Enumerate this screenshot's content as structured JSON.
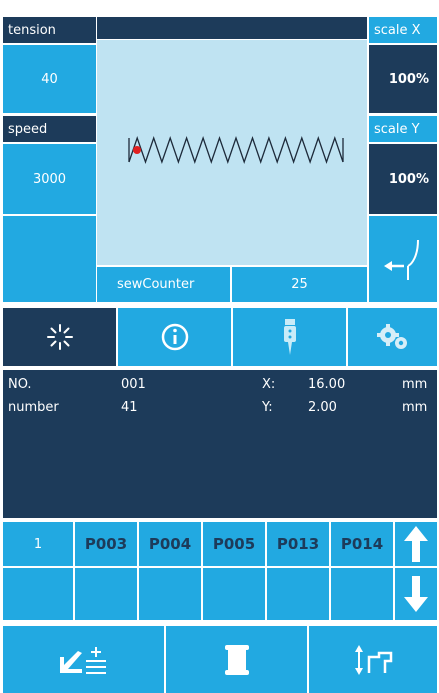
{
  "params": {
    "tension_label": "tension",
    "tension_value": "40",
    "speed_label": "speed",
    "speed_value": "3000",
    "scale_x_label": "scale X",
    "scale_x_value": "100%",
    "scale_y_label": "scale Y",
    "scale_y_value": "100%"
  },
  "counter": {
    "label": "sewCounter",
    "value": "25"
  },
  "tabs": [
    "sparkle-icon",
    "info-icon",
    "needle-icon",
    "gears-icon"
  ],
  "info": {
    "no_label": "NO.",
    "no_value": "001",
    "x_label": "X:",
    "x_value": "16.00",
    "x_unit": "mm",
    "number_label": "number",
    "number_value": "41",
    "y_label": "Y:",
    "y_value": "2.00",
    "y_unit": "mm"
  },
  "patterns": {
    "index": "1",
    "items": [
      "P003",
      "P004",
      "P005",
      "P013",
      "P014"
    ]
  },
  "bottom_buttons": [
    "pattern-edit-icon",
    "bobbin-icon",
    "presser-foot-icon"
  ],
  "colors": {
    "navy": "#1d3b5a",
    "cyan": "#22a9e1",
    "preview_bg": "#bfe3f2",
    "marker": "#e02020"
  }
}
